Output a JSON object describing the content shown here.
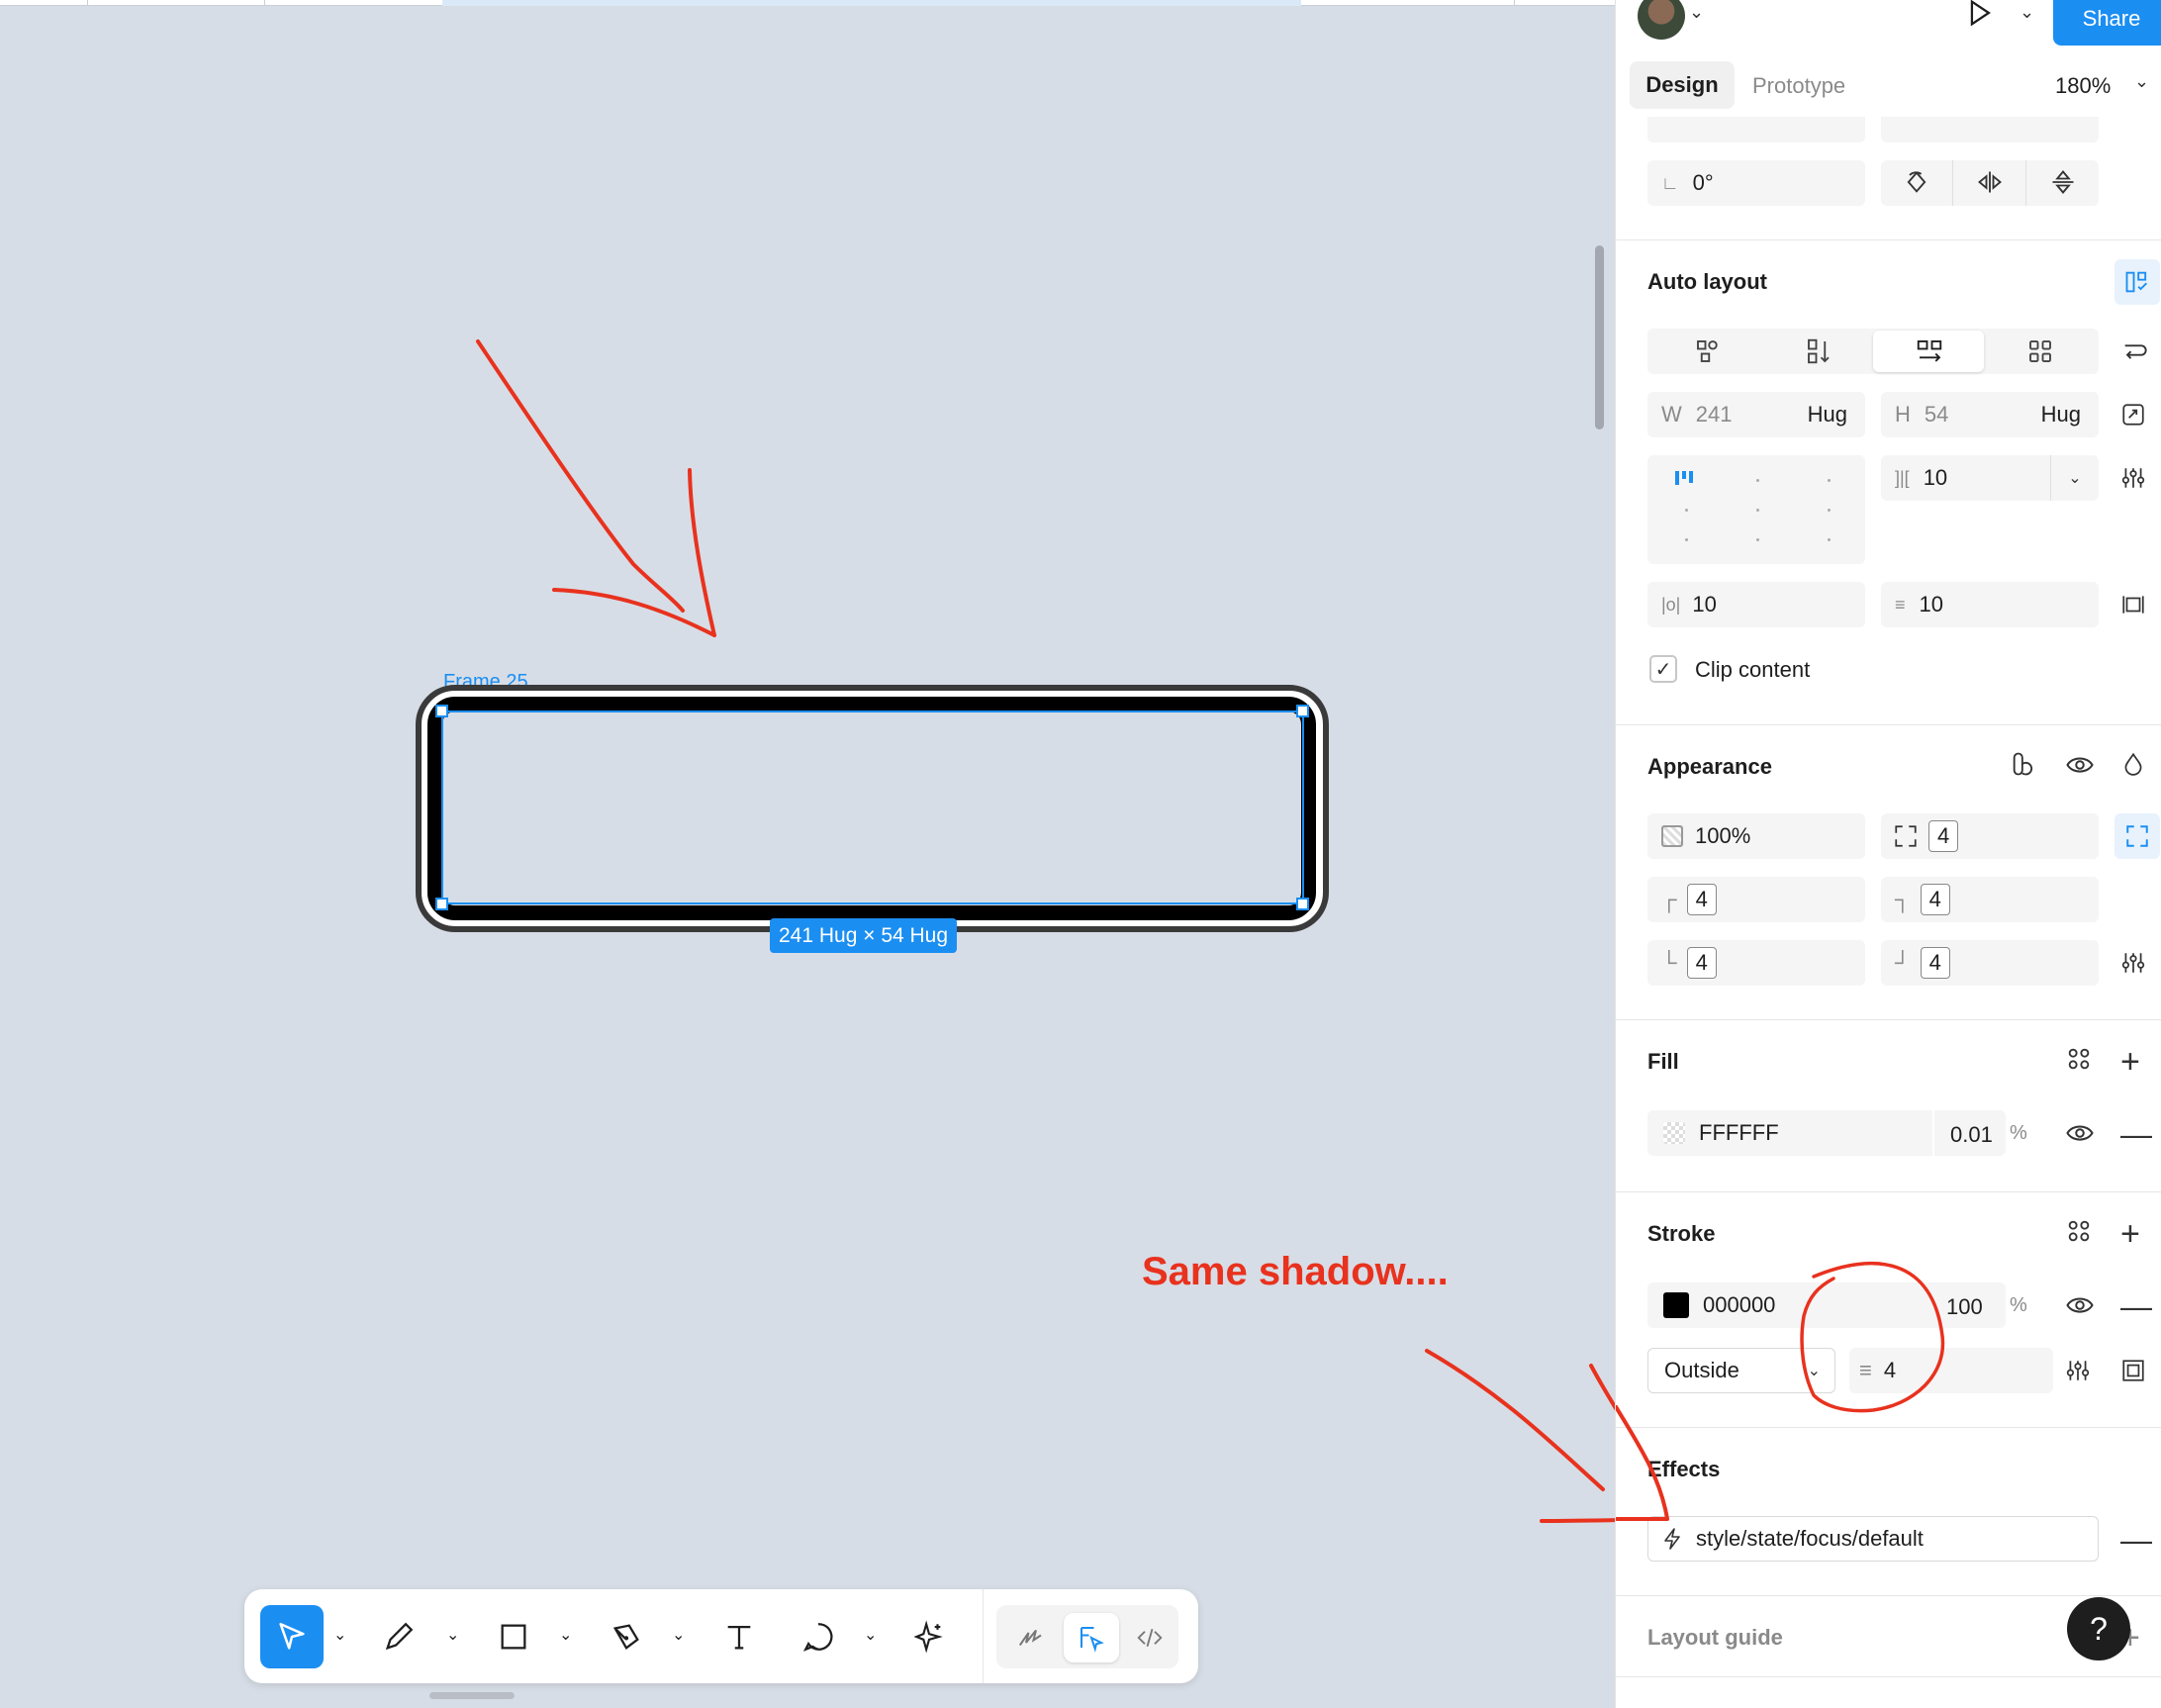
{
  "canvas": {
    "frame_label": "Frame 25",
    "size_badge": "241 Hug × 54 Hug",
    "annotation": "Same shadow...."
  },
  "toolbar": {
    "tools": [
      "move-tool",
      "pencil-tool",
      "rectangle-tool",
      "pen-tool",
      "text-tool",
      "comment-tool",
      "ai-tool"
    ],
    "modes": [
      "draw-mode",
      "design-mode",
      "dev-mode"
    ]
  },
  "panel": {
    "header": {
      "share_label": "Share"
    },
    "tabs": {
      "design": "Design",
      "prototype": "Prototype",
      "zoom": "180%"
    },
    "rotation": {
      "value": "0°"
    },
    "auto_layout": {
      "title": "Auto layout",
      "width_label": "W",
      "width_value": "241",
      "width_mode": "Hug",
      "height_label": "H",
      "height_value": "54",
      "height_mode": "Hug",
      "gap_value": "10",
      "padding_h": "10",
      "padding_v": "10",
      "clip_content": "Clip content"
    },
    "appearance": {
      "title": "Appearance",
      "opacity": "100%",
      "radius": "4",
      "radius_tl": "4",
      "radius_tr": "4",
      "radius_bl": "4",
      "radius_br": "4"
    },
    "fill": {
      "title": "Fill",
      "hex": "FFFFFF",
      "opacity": "0.01",
      "pct": "%"
    },
    "stroke": {
      "title": "Stroke",
      "hex": "000000",
      "opacity": "100",
      "pct": "%",
      "position": "Outside",
      "weight": "4"
    },
    "effects": {
      "title": "Effects",
      "style_name": "style/state/focus/default"
    },
    "layout_guide": {
      "title": "Layout guide"
    }
  },
  "colors": {
    "accent": "#1b8ef2",
    "annotation": "#e8321e",
    "canvas": "#d7dde6"
  }
}
